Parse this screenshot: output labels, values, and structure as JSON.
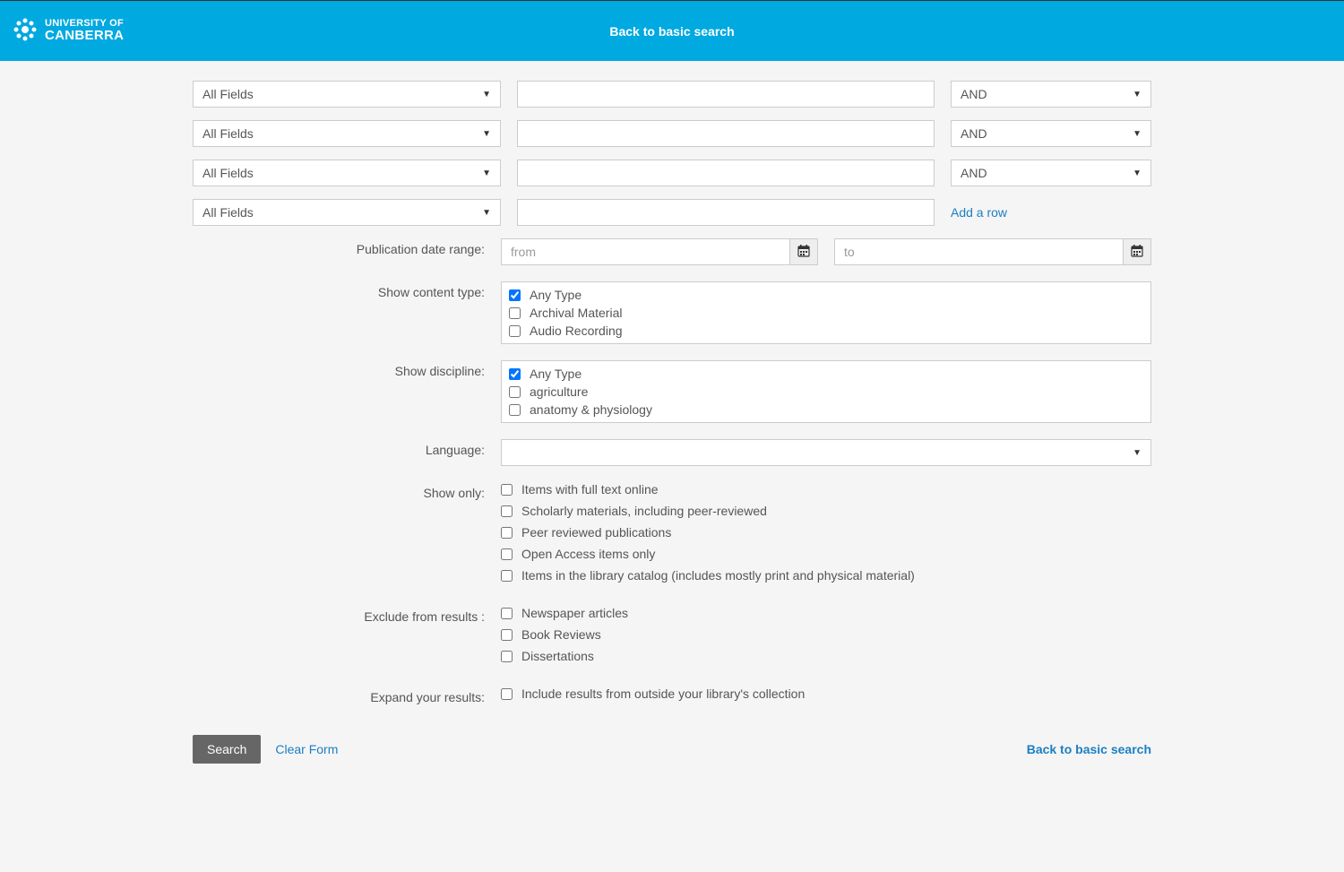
{
  "header": {
    "logo_line1": "UNIVERSITY OF",
    "logo_line2": "CANBERRA",
    "back_link": "Back to basic search"
  },
  "search_rows": [
    {
      "field": "All Fields",
      "op": "AND"
    },
    {
      "field": "All Fields",
      "op": "AND"
    },
    {
      "field": "All Fields",
      "op": "AND"
    },
    {
      "field": "All Fields",
      "op": ""
    }
  ],
  "add_row": "Add a row",
  "labels": {
    "pub_date": "Publication date range:",
    "content_type": "Show content type:",
    "discipline": "Show discipline:",
    "language": "Language:",
    "show_only": "Show only:",
    "exclude": "Exclude from results :",
    "expand": "Expand your results:"
  },
  "date": {
    "from_ph": "from",
    "to_ph": "to"
  },
  "content_types": [
    {
      "label": "Any Type",
      "checked": true
    },
    {
      "label": "Archival Material",
      "checked": false
    },
    {
      "label": "Audio Recording",
      "checked": false
    }
  ],
  "disciplines": [
    {
      "label": "Any Type",
      "checked": true
    },
    {
      "label": "agriculture",
      "checked": false
    },
    {
      "label": "anatomy & physiology",
      "checked": false
    }
  ],
  "show_only": [
    "Items with full text online",
    "Scholarly materials, including peer-reviewed",
    "Peer reviewed publications",
    "Open Access items only",
    "Items in the library catalog (includes mostly print and physical material)"
  ],
  "exclude": [
    "Newspaper articles",
    "Book Reviews",
    "Dissertations"
  ],
  "expand": [
    "Include results from outside your library's collection"
  ],
  "footer": {
    "search": "Search",
    "clear": "Clear Form",
    "back": "Back to basic search"
  }
}
